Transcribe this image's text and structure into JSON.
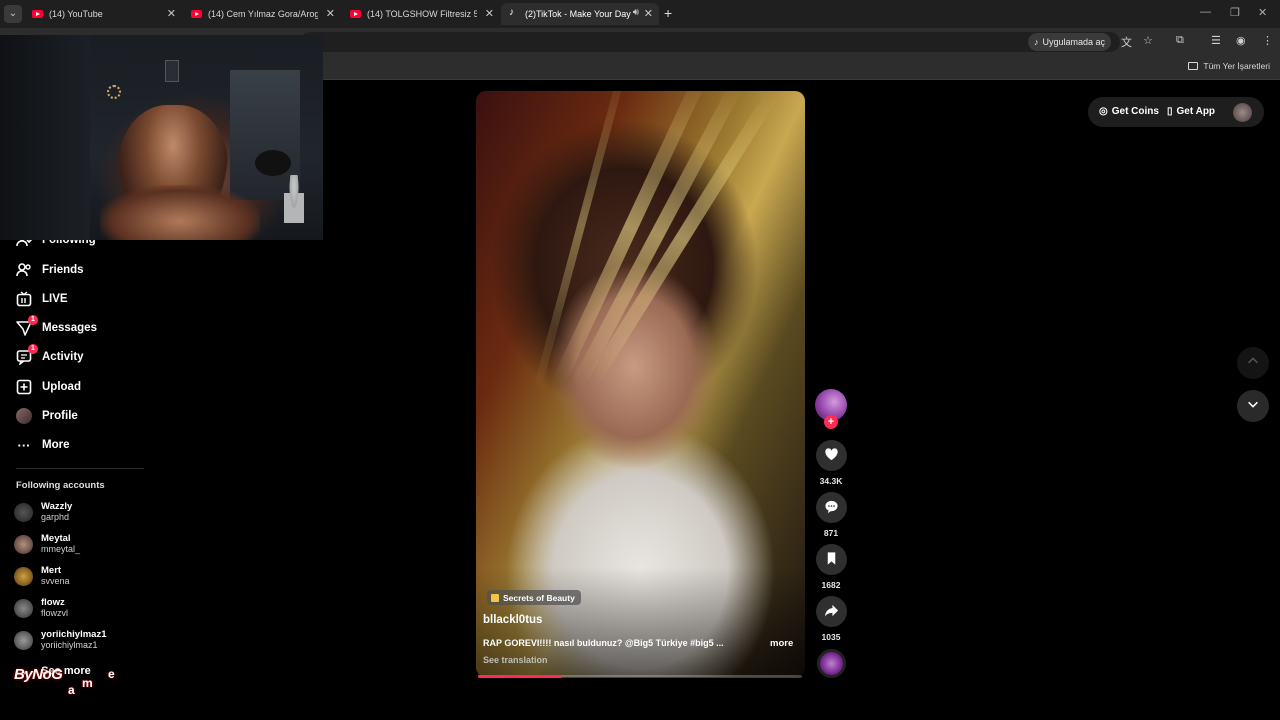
{
  "browser": {
    "tabs": [
      {
        "title": "(14) YouTube",
        "favicon": "youtube-icon"
      },
      {
        "title": "(14) Cem Yılmaz Gora/Arog Sa",
        "favicon": "youtube-icon"
      },
      {
        "title": "(14) TOLGSHOW Filtresiz 5. Bö",
        "favicon": "youtube-icon"
      },
      {
        "title": "(2)TikTok - Make Your Day",
        "favicon": "tiktok-icon",
        "active": true
      }
    ],
    "open_in_app_label": "Uygulamada aç",
    "all_bookmarks_label": "Tüm Yer İşaretleri"
  },
  "sidebar": {
    "items": [
      {
        "label": "Following",
        "icon": "following-icon"
      },
      {
        "label": "Friends",
        "icon": "friends-icon"
      },
      {
        "label": "LIVE",
        "icon": "live-icon"
      },
      {
        "label": "Messages",
        "icon": "messages-icon",
        "badge": "1"
      },
      {
        "label": "Activity",
        "icon": "activity-icon",
        "badge": "1"
      },
      {
        "label": "Upload",
        "icon": "upload-icon"
      },
      {
        "label": "Profile",
        "icon": "profile-icon"
      },
      {
        "label": "More",
        "icon": "more-icon"
      }
    ],
    "following_accounts_title": "Following accounts",
    "accounts": [
      {
        "name": "Wazzly",
        "handle": "garphd"
      },
      {
        "name": "Meytal",
        "handle": "mmeytal_"
      },
      {
        "name": "Mert",
        "handle": "svvena"
      },
      {
        "name": "flowz",
        "handle": "flowzvl"
      },
      {
        "name": "yoriichiylmaz1",
        "handle": "yoriichiylmaz1"
      }
    ],
    "see_more_label": "See more"
  },
  "header": {
    "get_coins_label": "Get Coins",
    "get_app_label": "Get App"
  },
  "video": {
    "sticker_label": "Secrets of Beauty",
    "author": "bllackl0tus",
    "caption": "RAP GOREVI!!!! nasıl buldunuz? @Big5 Türkiye #big5 ...",
    "more_label": "more",
    "see_translation_label": "See translation",
    "progress_fraction": 0.26
  },
  "actions": {
    "likes": "34.3K",
    "comments": "871",
    "saves": "1682",
    "shares": "1035"
  },
  "watermark": {
    "logo_text": "ByNoG",
    "game_letters": [
      "a",
      "m",
      "e"
    ]
  },
  "colors": {
    "accent": "#fe2c55",
    "background": "#000000"
  }
}
